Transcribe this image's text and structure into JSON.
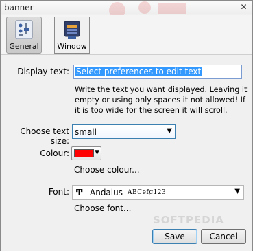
{
  "window": {
    "title": "banner",
    "close_glyph": "✕"
  },
  "toolbar": {
    "tabs": [
      {
        "label": "General",
        "icon": "general-settings-icon",
        "active": true
      },
      {
        "label": "Window",
        "icon": "window-icon",
        "active": false
      }
    ]
  },
  "form": {
    "display_text": {
      "label": "Display text:",
      "value": "Select preferences to edit text",
      "help": "Write the text you want displayed. Leaving it empty or using only spaces it not allowed! If it is too wide for the screen it will scroll."
    },
    "text_size": {
      "label": "Choose text size:",
      "value": "small"
    },
    "colour": {
      "label": "Colour:",
      "swatch": "#ff0000",
      "link": "Choose colour..."
    },
    "font": {
      "label": "Font:",
      "icon_glyph": "Ͳ",
      "name": "Andalus",
      "sample": "ABCefg123",
      "link": "Choose font..."
    }
  },
  "buttons": {
    "save": "Save",
    "cancel": "Cancel"
  },
  "watermark": "SOFTPEDIA"
}
